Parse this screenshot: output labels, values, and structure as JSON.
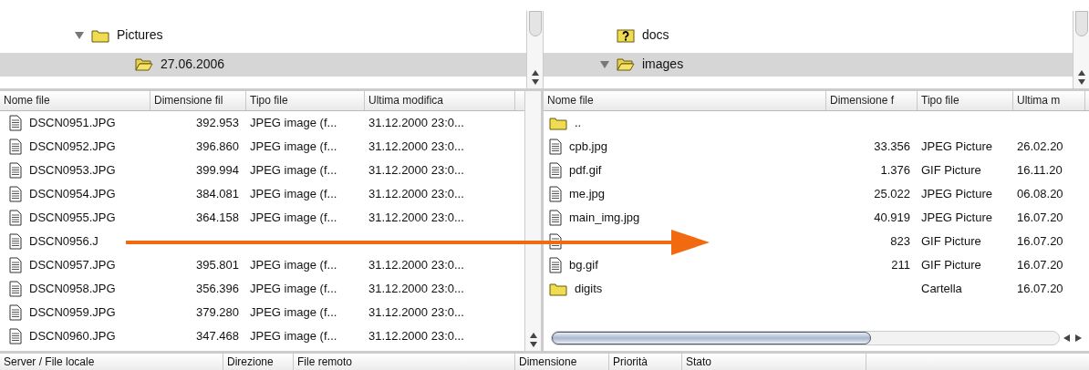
{
  "local_tree": {
    "items": [
      {
        "label": "Pictures",
        "kind": "folder",
        "expanded": true,
        "selected": false,
        "children": [
          {
            "label": "27.06.2006",
            "kind": "open-folder",
            "selected": true
          }
        ]
      }
    ]
  },
  "remote_tree": {
    "items": [
      {
        "label": "docs",
        "kind": "unknown-folder",
        "expanded": false,
        "selected": false
      },
      {
        "label": "images",
        "kind": "open-folder",
        "expanded": true,
        "selected": true
      }
    ]
  },
  "local_files": {
    "columns": [
      "Nome file",
      "Dimensione fil",
      "Tipo file",
      "Ultima modifica"
    ],
    "rows": [
      {
        "name": "DSCN0951.JPG",
        "size": "392.953",
        "type": "JPEG image (f...",
        "modified": "31.12.2000 23:0..."
      },
      {
        "name": "DSCN0952.JPG",
        "size": "396.860",
        "type": "JPEG image (f...",
        "modified": "31.12.2000 23:0..."
      },
      {
        "name": "DSCN0953.JPG",
        "size": "399.994",
        "type": "JPEG image (f...",
        "modified": "31.12.2000 23:0..."
      },
      {
        "name": "DSCN0954.JPG",
        "size": "384.081",
        "type": "JPEG image (f...",
        "modified": "31.12.2000 23:0..."
      },
      {
        "name": "DSCN0955.JPG",
        "size": "364.158",
        "type": "JPEG image (f...",
        "modified": "31.12.2000 23:0..."
      },
      {
        "name": "DSCN0956.J"
      },
      {
        "name": "DSCN0957.JPG",
        "size": "395.801",
        "type": "JPEG image (f...",
        "modified": "31.12.2000 23:0..."
      },
      {
        "name": "DSCN0958.JPG",
        "size": "356.396",
        "type": "JPEG image (f...",
        "modified": "31.12.2000 23:0..."
      },
      {
        "name": "DSCN0959.JPG",
        "size": "379.280",
        "type": "JPEG image (f...",
        "modified": "31.12.2000 23:0..."
      },
      {
        "name": "DSCN0960.JPG",
        "size": "347.468",
        "type": "JPEG image (f...",
        "modified": "31.12.2000 23:0..."
      }
    ]
  },
  "remote_files": {
    "columns": [
      "Nome file",
      "Dimensione f",
      "Tipo file",
      "Ultima m"
    ],
    "rows": [
      {
        "kind": "folder",
        "name": ".."
      },
      {
        "kind": "file",
        "name": "cpb.jpg",
        "size": "33.356",
        "type": "JPEG Picture",
        "modified": "26.02.20"
      },
      {
        "kind": "file",
        "name": "pdf.gif",
        "size": "1.376",
        "type": "GIF Picture",
        "modified": "16.11.20"
      },
      {
        "kind": "file",
        "name": "me.jpg",
        "size": "25.022",
        "type": "JPEG Picture",
        "modified": "06.08.20"
      },
      {
        "kind": "file",
        "name": "main_img.jpg",
        "size": "40.919",
        "type": "JPEG Picture",
        "modified": "16.07.20"
      },
      {
        "kind": "file",
        "size": "823",
        "type": "GIF Picture",
        "modified": "16.07.20"
      },
      {
        "kind": "file",
        "name": "bg.gif",
        "size": "211",
        "type": "GIF Picture",
        "modified": "16.07.20"
      },
      {
        "kind": "folder",
        "name": "digits",
        "type": "Cartella",
        "modified": "16.07.20"
      }
    ]
  },
  "queue": {
    "columns": [
      "Server / File locale",
      "Direzione",
      "File remoto",
      "Dimensione",
      "Priorità",
      "Stato"
    ]
  }
}
